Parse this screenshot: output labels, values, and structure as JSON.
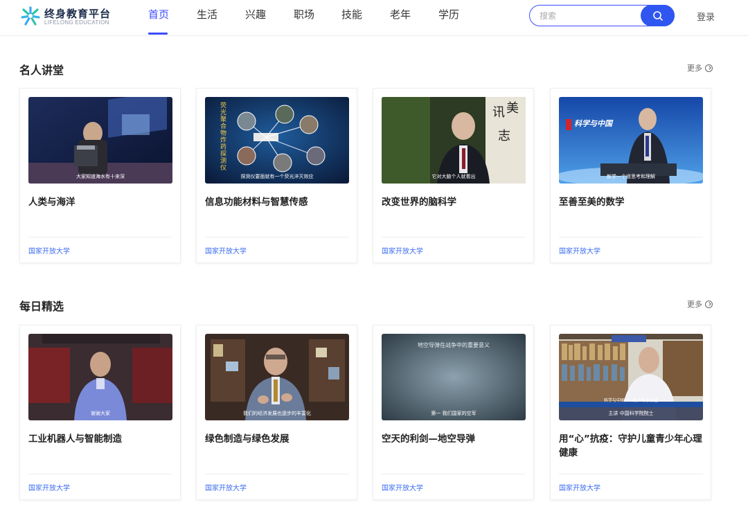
{
  "brand": {
    "name": "终身教育平台",
    "subtitle": "LIFELONG EDUCATION"
  },
  "nav": {
    "items": [
      "首页",
      "生活",
      "兴趣",
      "职场",
      "技能",
      "老年",
      "学历"
    ],
    "active_index": 0
  },
  "search": {
    "placeholder": "搜索"
  },
  "login_label": "登录",
  "accent_color": "#3b4bff",
  "sections": [
    {
      "title": "名人讲堂",
      "more_label": "更多",
      "cards": [
        {
          "title": "人类与海洋",
          "source": "国家开放大学",
          "caption": "大家知道海水有十来深"
        },
        {
          "title": "信息功能材料与智慧传感",
          "source": "国家开放大学",
          "caption": "探测仪要面就有一个荧光淬灭效应",
          "slide_text": "荧光聚合物炸药探测仪"
        },
        {
          "title": "改变世界的脑科学",
          "source": "国家开放大学",
          "caption": "它对大脑个人就看出"
        },
        {
          "title": "至善至美的数学",
          "source": "国家开放大学",
          "caption": "新学一个道思考和理解",
          "logo_text": "科学与中国"
        }
      ]
    },
    {
      "title": "每日精选",
      "more_label": "更多",
      "cards": [
        {
          "title": "工业机器人与智能制造",
          "source": "国家开放大学",
          "caption": "谢谢大家"
        },
        {
          "title": "绿色制造与绿色发展",
          "source": "国家开放大学",
          "caption": "我们的经济发展也逐步的丰富化"
        },
        {
          "title": "空天的利剑—地空导弹",
          "source": "国家开放大学",
          "caption": "第一 我们国家的空军",
          "header_text": "地空导弹在战争中的重要意义"
        },
        {
          "title": "用“心”抗疫：守护儿童青少年心理健康",
          "source": "国家开放大学",
          "caption": "主讲 中国科学院院士",
          "banner_text": "科学与中国——院士专家讲座"
        }
      ]
    }
  ]
}
